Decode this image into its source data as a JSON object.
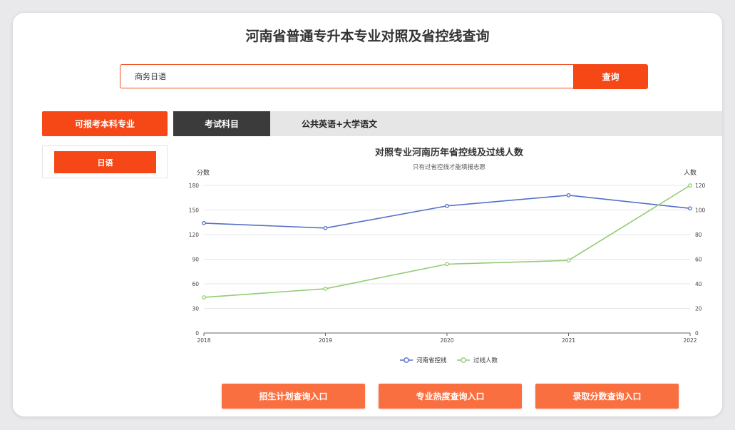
{
  "page": {
    "title": "河南省普通专升本专业对照及省控线查询"
  },
  "search": {
    "value": "商务日语",
    "button_label": "查询"
  },
  "majors": {
    "header_label": "可报考本科专业",
    "items": [
      {
        "label": "日语"
      }
    ]
  },
  "subjects": {
    "label": "考试科目",
    "value": "公共英语+大学语文"
  },
  "actions": [
    {
      "label": "招生计划查询入口"
    },
    {
      "label": "专业热度查询入口"
    },
    {
      "label": "录取分数查询入口"
    }
  ],
  "colors": {
    "accent": "#f64716",
    "action": "#fa6f40",
    "series_score": "#5470c6",
    "series_count": "#91cc75"
  },
  "chart_data": {
    "type": "line",
    "title": "对照专业河南历年省控线及过线人数",
    "subtitle": "只有过省控线才能填报志愿",
    "x": [
      "2018",
      "2019",
      "2020",
      "2021",
      "2022"
    ],
    "y_left": {
      "label": "分数",
      "min": 0,
      "max": 180,
      "ticks": [
        0,
        30,
        60,
        90,
        120,
        150,
        180
      ]
    },
    "y_right": {
      "label": "人数",
      "min": 0,
      "max": 120,
      "ticks": [
        0,
        20,
        40,
        60,
        80,
        100,
        120
      ]
    },
    "series": [
      {
        "name": "河南省控线",
        "axis": "left",
        "values": [
          134,
          128,
          155,
          168,
          152
        ]
      },
      {
        "name": "过线人数",
        "axis": "right",
        "values": [
          29,
          36,
          56,
          59,
          120
        ]
      }
    ],
    "legend_position": "bottom",
    "grid": true
  }
}
